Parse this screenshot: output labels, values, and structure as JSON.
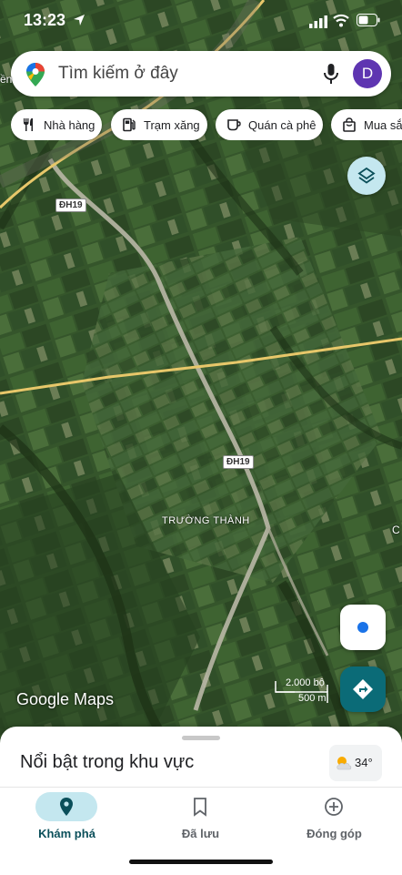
{
  "status_bar": {
    "time": "13:23"
  },
  "search": {
    "placeholder": "Tìm kiếm ở đây",
    "avatar_letter": "D"
  },
  "chips": [
    {
      "label": "Nhà hàng",
      "icon": "utensils-icon"
    },
    {
      "label": "Trạm xăng",
      "icon": "gas-station-icon"
    },
    {
      "label": "Quán cà phê",
      "icon": "coffee-icon"
    },
    {
      "label": "Mua sắm",
      "icon": "shopping-bag-icon"
    }
  ],
  "map": {
    "road_labels": [
      "ĐH19",
      "ĐH19"
    ],
    "place_label": "TRƯỜNG THÀNH",
    "edge_letters": [
      "ền",
      "C"
    ],
    "attribution": "Google Maps",
    "scale": {
      "imperial": "2.000 bộ",
      "metric": "500 m"
    }
  },
  "sheet": {
    "heading": "Nổi bật trong khu vực",
    "weather_temp": "34°"
  },
  "nav": [
    {
      "label": "Khám phá",
      "icon": "explore-pin-icon",
      "active": true
    },
    {
      "label": "Đã lưu",
      "icon": "bookmark-icon",
      "active": false
    },
    {
      "label": "Đóng góp",
      "icon": "add-circle-icon",
      "active": false
    }
  ],
  "colors": {
    "accent": "#0b6b77",
    "active_pill": "#c4e7ef",
    "avatar": "#5e35b1",
    "location_dot": "#1a73e8"
  }
}
